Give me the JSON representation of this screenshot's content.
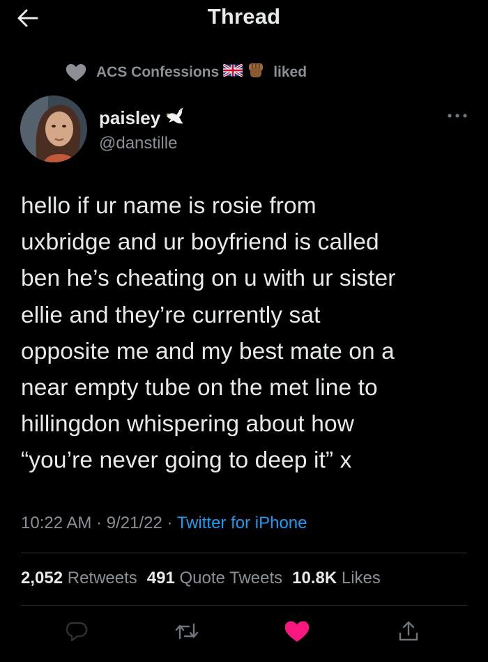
{
  "header": {
    "title": "Thread",
    "back_icon": "arrow-left-icon"
  },
  "social_context": {
    "icon": "heart-icon",
    "name": "ACS Confessions",
    "emoji_flag": "🇬🇧",
    "emoji_fist": "✊🏾",
    "action": "liked"
  },
  "author": {
    "display_name": "paisley",
    "name_emoji": "dove-icon",
    "handle": "@danstille"
  },
  "tweet": {
    "lines": [
      "hello if ur name is rosie from",
      "uxbridge and ur boyfriend is called",
      "ben he’s cheating on u with ur sister",
      "ellie and they’re currently sat",
      "opposite me and my best mate on a",
      "near empty tube on the met line to",
      "hillingdon whispering about how",
      "“you’re never going to deep it” x"
    ]
  },
  "meta": {
    "time": "10:22 AM",
    "date": "9/21/22",
    "separator": "·",
    "source": "Twitter for iPhone"
  },
  "stats": {
    "retweets_count": "2,052",
    "retweets_label": "Retweets",
    "quotes_count": "491",
    "quotes_label": "Quote Tweets",
    "likes_count": "10.8K",
    "likes_label": "Likes"
  },
  "colors": {
    "background": "#000000",
    "text": "#e7e9ea",
    "secondary": "#8b9096",
    "link": "#1d9bf0",
    "like": "#f91880",
    "divider": "#2f3336"
  }
}
